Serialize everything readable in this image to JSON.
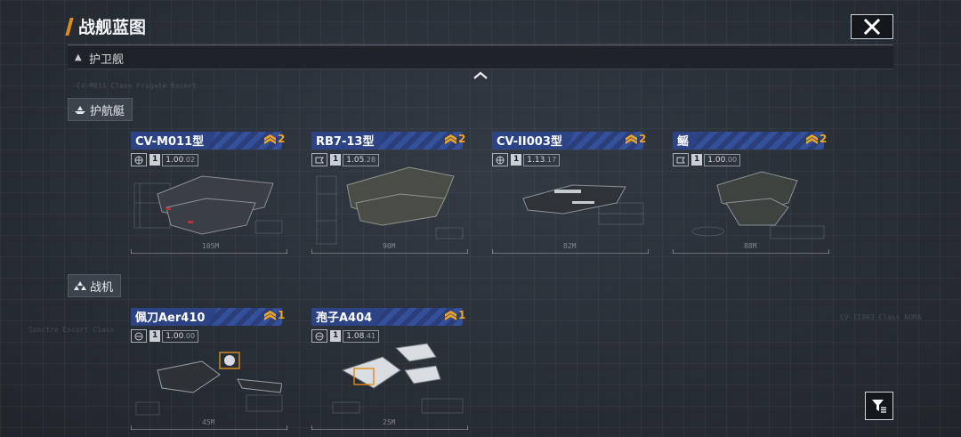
{
  "page": {
    "title": "战舰蓝图"
  },
  "category": {
    "label": "护卫舰"
  },
  "sections": [
    {
      "label": "护航艇",
      "ships": [
        {
          "name": "CV-M011型",
          "rank": "2",
          "level": "1",
          "version": "1.00",
          "version_sub": ".02",
          "length": "105M",
          "class_icon": "globe-icon"
        },
        {
          "name": "RB7-13型",
          "rank": "2",
          "level": "1",
          "version": "1.05",
          "version_sub": ".28",
          "length": "90M",
          "class_icon": "flag-icon"
        },
        {
          "name": "CV-II003型",
          "rank": "2",
          "level": "1",
          "version": "1.13",
          "version_sub": ".17",
          "length": "82M",
          "class_icon": "globe-icon"
        },
        {
          "name": "鳐",
          "rank": "2",
          "level": "1",
          "version": "1.00",
          "version_sub": ".00",
          "length": "88M",
          "class_icon": "flag-icon"
        }
      ]
    },
    {
      "label": "战机",
      "ships": [
        {
          "name": "佩刀Aer410",
          "rank": "1",
          "level": "1",
          "version": "1.00",
          "version_sub": ".00",
          "length": "45M",
          "class_icon": "aircraft-icon"
        },
        {
          "name": "孢子A404",
          "rank": "1",
          "level": "1",
          "version": "1.08",
          "version_sub": ".41",
          "length": "25M",
          "class_icon": "aircraft-icon"
        }
      ]
    }
  ],
  "colors": {
    "accent": "#e08a1a",
    "rank": "#f2a51c",
    "card_header": "#2c4486"
  }
}
